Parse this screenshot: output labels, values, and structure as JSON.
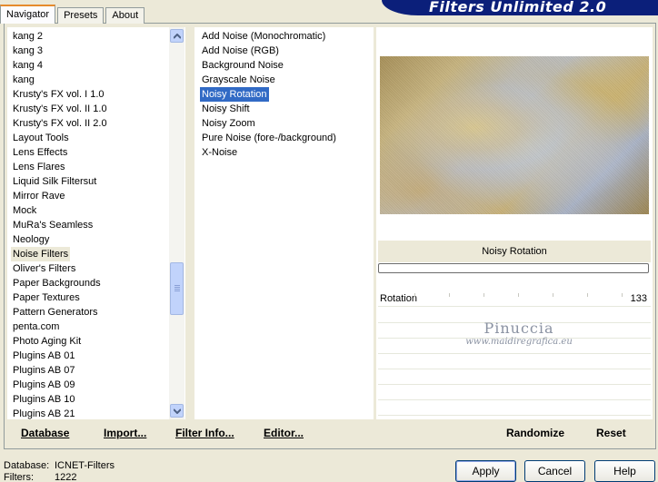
{
  "tabs": [
    "Navigator",
    "Presets",
    "About"
  ],
  "banner_title": "Filters Unlimited 2.0",
  "categories": [
    {
      "label": "kang 2"
    },
    {
      "label": "kang 3"
    },
    {
      "label": "kang 4"
    },
    {
      "label": "kang"
    },
    {
      "label": "Krusty's FX vol. I 1.0"
    },
    {
      "label": "Krusty's FX vol. II 1.0"
    },
    {
      "label": "Krusty's FX vol. II 2.0"
    },
    {
      "label": "Layout Tools"
    },
    {
      "label": "Lens Effects"
    },
    {
      "label": "Lens Flares"
    },
    {
      "label": "Liquid Silk Filtersut"
    },
    {
      "label": "Mirror Rave"
    },
    {
      "label": "Mock"
    },
    {
      "label": "MuRa's Seamless"
    },
    {
      "label": "Neology"
    },
    {
      "label": "Noise Filters",
      "selected": true
    },
    {
      "label": "Oliver's Filters"
    },
    {
      "label": "Paper Backgrounds"
    },
    {
      "label": "Paper Textures"
    },
    {
      "label": "Pattern Generators"
    },
    {
      "label": "penta.com"
    },
    {
      "label": "Photo Aging Kit"
    },
    {
      "label": "Plugins AB 01"
    },
    {
      "label": "Plugins AB 07"
    },
    {
      "label": "Plugins AB 09"
    },
    {
      "label": "Plugins AB 10"
    },
    {
      "label": "Plugins AB 21"
    }
  ],
  "filters": [
    {
      "label": "Add Noise (Monochromatic)"
    },
    {
      "label": "Add Noise (RGB)"
    },
    {
      "label": "Background Noise"
    },
    {
      "label": "Grayscale Noise"
    },
    {
      "label": "Noisy Rotation",
      "selected": true
    },
    {
      "label": "Noisy Shift"
    },
    {
      "label": "Noisy Zoom"
    },
    {
      "label": "Pure Noise (fore-/background)"
    },
    {
      "label": "X-Noise"
    }
  ],
  "preview": {
    "filter_name": "Noisy Rotation",
    "params": [
      {
        "label": "Rotation",
        "value": "133"
      }
    ],
    "watermark_line1": "Pinuccia",
    "watermark_line2": "www.maidiregrafica.eu"
  },
  "toolbar": {
    "database": "Database",
    "import": "Import...",
    "filter_info": "Filter Info...",
    "editor": "Editor...",
    "randomize": "Randomize",
    "reset": "Reset"
  },
  "status": {
    "database_label": "Database:",
    "database_value": "ICNET-Filters",
    "filters_label": "Filters:",
    "filters_value": "1222"
  },
  "buttons": {
    "apply": "Apply",
    "cancel": "Cancel",
    "help": "Help"
  },
  "colors": {
    "banner": "#0b1f7a",
    "selection": "#316ac5",
    "tab_accent": "#e68b2c"
  }
}
